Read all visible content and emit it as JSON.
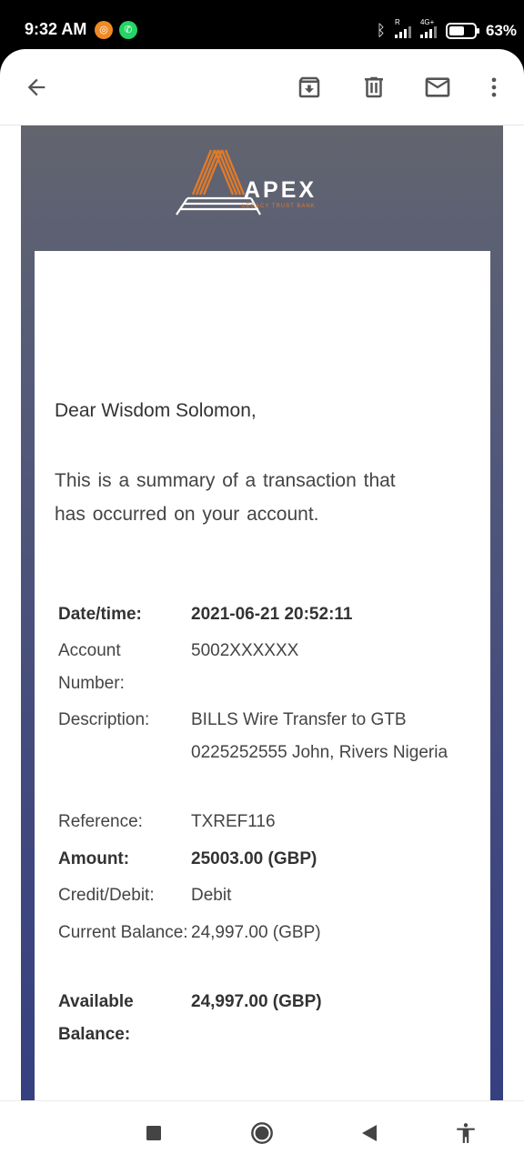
{
  "status_bar": {
    "time": "9:32 AM",
    "battery": "63%",
    "battery_level": 0.63,
    "network_tag": "4G+",
    "roaming_tag": "R"
  },
  "toolbar": {
    "back": "arrow-left-icon",
    "archive": "archive-icon",
    "delete": "trash-icon",
    "mark_unread": "mail-icon",
    "more": "more-vert-icon"
  },
  "email": {
    "brand": {
      "name": "APEX",
      "tagline": "LEGACY TRUST BANK",
      "accent_color": "#e07a2a"
    },
    "greeting": "Dear Wisdom Solomon,",
    "summary": "This is a summary of a transaction that has occurred on your account.",
    "details": [
      {
        "label": "Date/time:",
        "value": "2021-06-21 20:52:11",
        "bold": true
      },
      {
        "label": "Account Number:",
        "value": "5002XXXXXX",
        "bold": false
      },
      {
        "label": "Description:",
        "value": "BILLS Wire Transfer to GTB 0225252555 John, Rivers Nigeria",
        "bold": false
      },
      {
        "label": "Reference:",
        "value": "TXREF116",
        "bold": false
      },
      {
        "label": "Amount:",
        "value": "25003.00 (GBP)",
        "bold": true
      },
      {
        "label": "Credit/Debit:",
        "value": "Debit",
        "bold": false
      },
      {
        "label": "Current Balance:",
        "value": "24,997.00 (GBP)",
        "bold": false
      },
      {
        "label": "Available Balance:",
        "value": "24,997.00 (GBP)",
        "bold": true
      }
    ]
  },
  "nav_bar": {
    "recents": "square-icon",
    "home": "circle-icon",
    "back": "triangle-back-icon",
    "accessibility": "accessibility-icon"
  }
}
